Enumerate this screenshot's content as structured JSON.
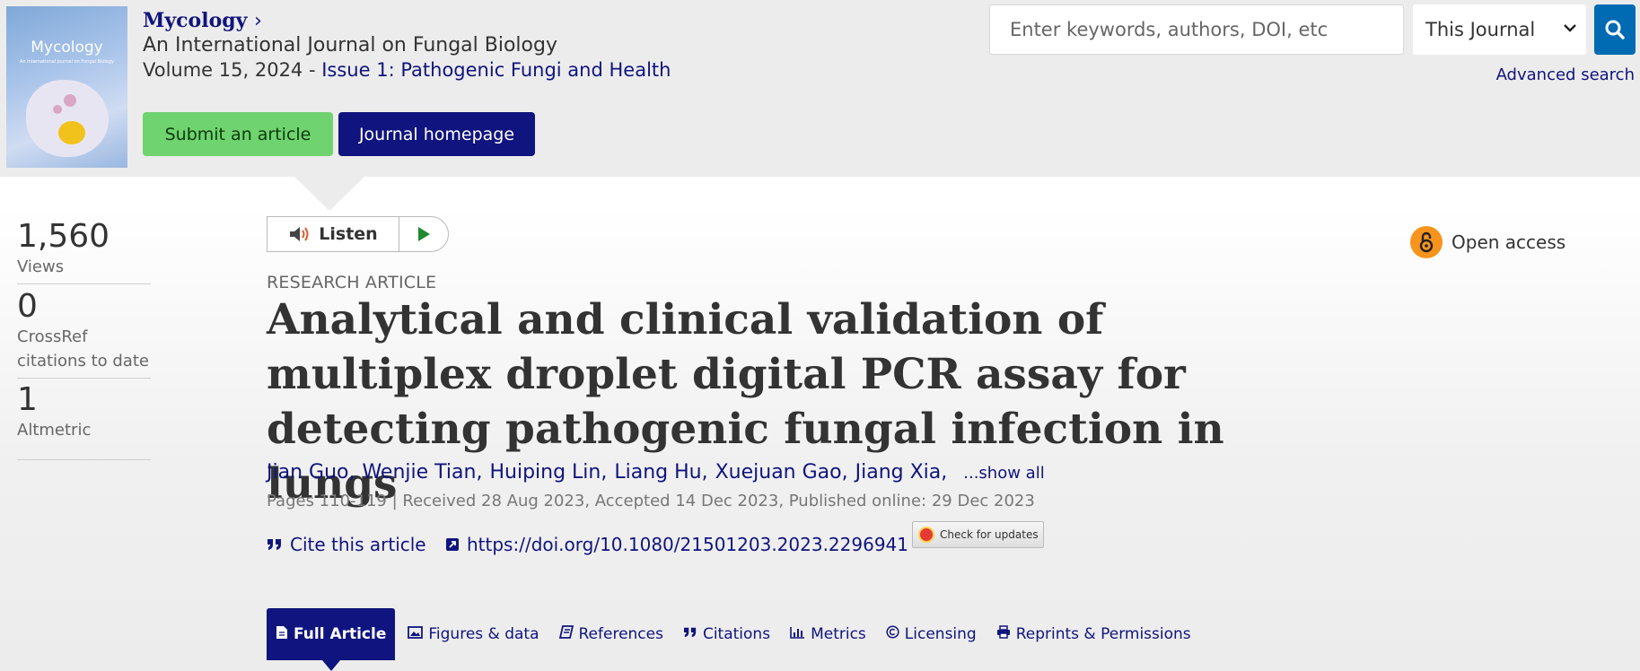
{
  "header": {
    "cover": {
      "title": "Mycology",
      "subtitle": "An International Journal on Fungal Biology"
    },
    "journal_name": "Mycology",
    "journal_subtitle": "An International Journal on Fungal Biology",
    "volume_text": "Volume 15, 2024 - ",
    "issue_link": "Issue 1: Pathogenic Fungi and Health",
    "submit_label": "Submit an article",
    "homepage_label": "Journal homepage"
  },
  "search": {
    "placeholder": "Enter keywords, authors, DOI, etc",
    "scope": "This Journal",
    "advanced": "Advanced search"
  },
  "metrics": [
    {
      "value": "1,560",
      "label": "Views"
    },
    {
      "value": "0",
      "label_line1": "CrossRef",
      "label_line2": "citations to date"
    },
    {
      "value": "1",
      "label": "Altmetric"
    }
  ],
  "player": {
    "listen_label": "Listen"
  },
  "article": {
    "open_access": "Open access",
    "type": "RESEARCH ARTICLE",
    "title": "Analytical and clinical validation of multiplex droplet digital PCR assay for detecting pathogenic fungal infection in lungs",
    "authors": [
      "Jian Guo,",
      "Wenjie Tian,",
      "Huiping Lin,",
      "Liang Hu,",
      "Xuejuan Gao,",
      "Jiang Xia,"
    ],
    "show_all": "...show all",
    "pub_info": "Pages 110-119 | Received 28 Aug 2023, Accepted 14 Dec 2023, Published online: 29 Dec 2023",
    "cite_label": "Cite this article",
    "doi": "https://doi.org/10.1080/21501203.2023.2296941",
    "check_updates": "Check for updates"
  },
  "tabs": [
    {
      "label": "Full Article",
      "icon": "document-icon",
      "active": true
    },
    {
      "label": "Figures & data",
      "icon": "image-icon"
    },
    {
      "label": "References",
      "icon": "book-icon"
    },
    {
      "label": "Citations",
      "icon": "quote-icon"
    },
    {
      "label": "Metrics",
      "icon": "bar-chart-icon"
    },
    {
      "label": "Licensing",
      "icon": "copyright-icon"
    },
    {
      "label": "Reprints & Permissions",
      "icon": "print-icon"
    }
  ],
  "colors": {
    "brand_navy": "#10147e",
    "submit_green": "#6fd36f",
    "search_blue": "#006ab3",
    "open_access_orange": "#f7941d"
  }
}
